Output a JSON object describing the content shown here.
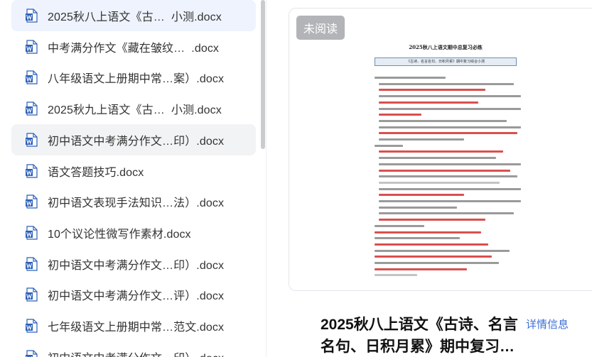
{
  "files": [
    {
      "name": "2025秋八上语文《古…  小测.docx",
      "state": "selected"
    },
    {
      "name": "中考满分作文《藏在皱纹…  .docx",
      "state": ""
    },
    {
      "name": "八年级语文上册期中常…案）.docx",
      "state": ""
    },
    {
      "name": "2025秋九上语文《古…  小测.docx",
      "state": ""
    },
    {
      "name": "初中语文中考满分作文…印）.docx",
      "state": "hover"
    },
    {
      "name": "语文答题技巧.docx",
      "state": ""
    },
    {
      "name": "初中语文表现手法知识…法）.docx",
      "state": ""
    },
    {
      "name": "10个议论性微写作素材.docx",
      "state": ""
    },
    {
      "name": "初中语文中考满分作文…印）.docx",
      "state": ""
    },
    {
      "name": "初中语文中考满分作文…评）.docx",
      "state": ""
    },
    {
      "name": "七年级语文上册期中常…范文.docx",
      "state": ""
    },
    {
      "name": "初中语文中考满分作文…印）.docx",
      "state": ""
    }
  ],
  "preview": {
    "unread_badge": "未阅读",
    "thumb_title": "2025秋八上语文期中总复习必练",
    "thumb_subtitle": "《古诗、名言名句、日积月累》期中复习综合小测"
  },
  "document": {
    "title": "2025秋八上语文《古诗、名言名句、日积月累》期中复习…",
    "details_link": "详情信息"
  },
  "colors": {
    "word_icon": "#2b5fb8",
    "selected_bg": "#eef3fd",
    "link": "#3c6fd6"
  }
}
